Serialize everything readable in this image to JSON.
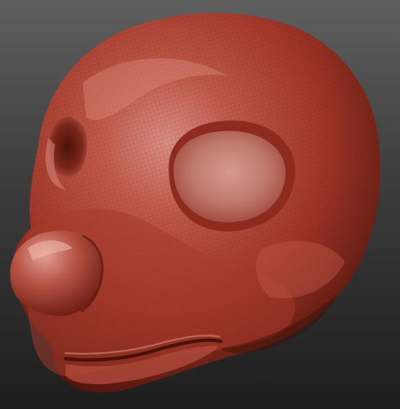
{
  "viewport": {
    "background_top": "#5f5f5f",
    "background_bottom": "#1d1d1d"
  },
  "model": {
    "material_base": "#a2382a",
    "material_highlight": "#d9897a",
    "material_shadow": "#3e1008",
    "wireframe_visible": true
  }
}
